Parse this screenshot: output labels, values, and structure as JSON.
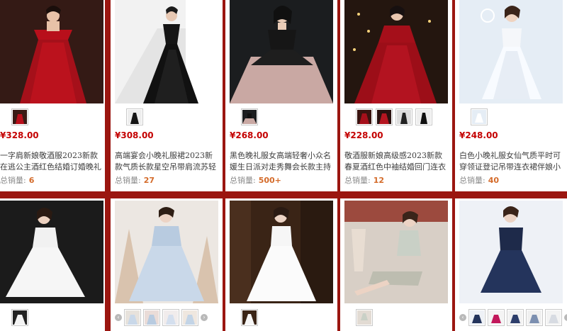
{
  "products": [
    {
      "price": "¥328.00",
      "title": "一字肩新娘敬酒服2023新款在逃公主酒红色结婚订婚晚礼服裙长款",
      "sales_label": "总销量:",
      "sales_count": "6",
      "thumb_count": 1
    },
    {
      "price": "¥308.00",
      "title": "高端宴会小晚礼服裙2023新款气质长款星空吊带肩流苏轻奢主持人",
      "sales_label": "总销量:",
      "sales_count": "27",
      "thumb_count": 1
    },
    {
      "price": "¥268.00",
      "title": "黑色晚礼服女高端轻奢小众名媛生日派对走秀舞会长款主持演出服冬",
      "sales_label": "总销量:",
      "sales_count": "500+",
      "thumb_count": 1
    },
    {
      "price": "¥228.00",
      "title": "敬酒服新娘高级感2023新款春夏酒红色中袖结婚回门连衣裙宴会礼",
      "sales_label": "总销量:",
      "sales_count": "12",
      "thumb_count": 4
    },
    {
      "price": "¥248.00",
      "title": "白色小晚礼服女仙气质平时可穿领证登记吊带连衣裙伴娘小个子夏季",
      "sales_label": "总销量:",
      "sales_count": "40",
      "thumb_count": 1
    },
    {
      "thumb_count": 1
    },
    {
      "thumb_count": 4
    },
    {
      "thumb_count": 1
    },
    {
      "thumb_count": 1
    },
    {
      "thumb_count": 5
    }
  ],
  "nav": {
    "prev": "‹",
    "next": "›"
  },
  "colors": {
    "background": "#9b1610",
    "price": "#c40000",
    "sales_count": "#d46b2a"
  }
}
